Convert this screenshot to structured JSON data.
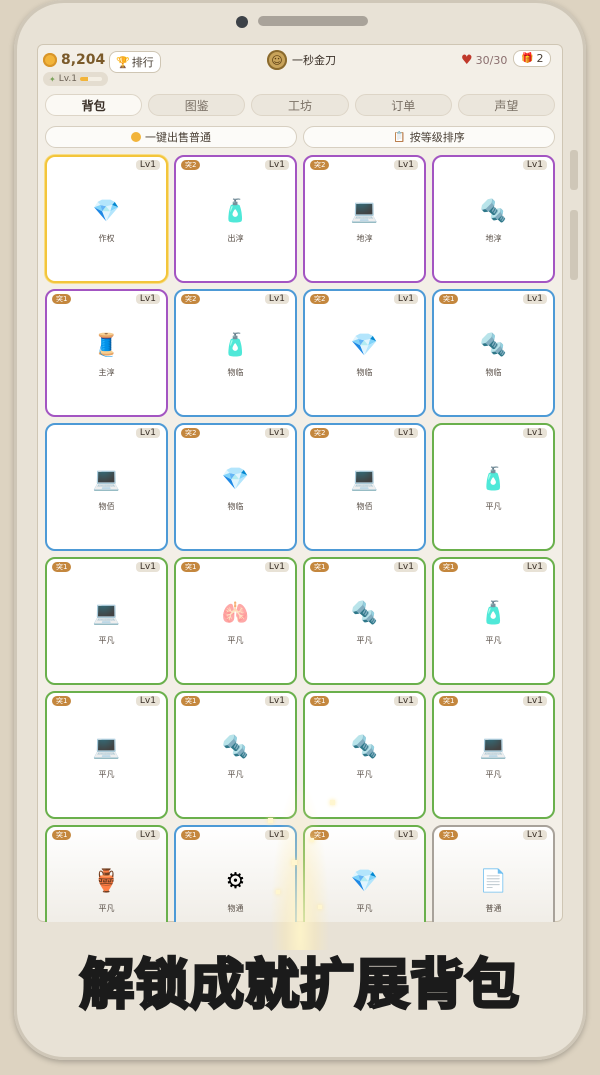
{
  "header": {
    "coins": "8,204",
    "rank_label": "排行",
    "level_label": "Lv.1",
    "level_progress": 0.35,
    "player_name": "一秒金刀",
    "stamina": "30/30",
    "gift_count": "2"
  },
  "tabs": [
    {
      "label": "背包",
      "active": true
    },
    {
      "label": "图鉴",
      "active": false
    },
    {
      "label": "工坊",
      "active": false
    },
    {
      "label": "订单",
      "active": false
    },
    {
      "label": "声望",
      "active": false
    }
  ],
  "actions": {
    "sell_all": "一键出售普通",
    "sort": "按等级排序"
  },
  "items": [
    {
      "lv": "Lv1",
      "badge": "",
      "icon": "💎",
      "icon_name": "diamond-icon",
      "label": "作权",
      "rarity": "gold"
    },
    {
      "lv": "Lv1",
      "badge": "突2",
      "icon": "🧴",
      "icon_name": "lotion-bottle-icon",
      "label": "出淳",
      "rarity": "purple"
    },
    {
      "lv": "Lv1",
      "badge": "突2",
      "icon": "💻",
      "icon_name": "laptop-icon",
      "label": "地淳",
      "rarity": "purple"
    },
    {
      "lv": "Lv1",
      "badge": "",
      "icon": "🔩",
      "icon_name": "bolt-icon",
      "label": "地淳",
      "rarity": "purple"
    },
    {
      "lv": "Lv1",
      "badge": "突1",
      "icon": "🧵",
      "icon_name": "thread-spool-icon",
      "label": "主淳",
      "rarity": "purple"
    },
    {
      "lv": "Lv1",
      "badge": "突2",
      "icon": "🧴",
      "icon_name": "lotion-bottle-icon",
      "label": "物临",
      "rarity": "blue"
    },
    {
      "lv": "Lv1",
      "badge": "突2",
      "icon": "💎",
      "icon_name": "diamond-icon",
      "label": "物临",
      "rarity": "blue"
    },
    {
      "lv": "Lv1",
      "badge": "突1",
      "icon": "🔩",
      "icon_name": "bolt-icon",
      "label": "物临",
      "rarity": "blue"
    },
    {
      "lv": "Lv1",
      "badge": "",
      "icon": "💻",
      "icon_name": "laptop-icon",
      "label": "物佰",
      "rarity": "blue"
    },
    {
      "lv": "Lv1",
      "badge": "突2",
      "icon": "💎",
      "icon_name": "diamond-icon",
      "label": "物临",
      "rarity": "blue"
    },
    {
      "lv": "Lv1",
      "badge": "突2",
      "icon": "💻",
      "icon_name": "laptop-icon",
      "label": "物佰",
      "rarity": "blue"
    },
    {
      "lv": "Lv1",
      "badge": "",
      "icon": "🧴",
      "icon_name": "lotion-bottle-icon",
      "label": "平凡",
      "rarity": "green"
    },
    {
      "lv": "Lv1",
      "badge": "突1",
      "icon": "💻",
      "icon_name": "laptop-icon",
      "label": "平凡",
      "rarity": "green"
    },
    {
      "lv": "Lv1",
      "badge": "突1",
      "icon": "🫁",
      "icon_name": "lungs-icon",
      "label": "平凡",
      "rarity": "green"
    },
    {
      "lv": "Lv1",
      "badge": "突1",
      "icon": "🔩",
      "icon_name": "bolt-icon",
      "label": "平凡",
      "rarity": "green"
    },
    {
      "lv": "Lv1",
      "badge": "突1",
      "icon": "🧴",
      "icon_name": "lotion-bottle-icon",
      "label": "平凡",
      "rarity": "green"
    },
    {
      "lv": "Lv1",
      "badge": "突1",
      "icon": "💻",
      "icon_name": "laptop-icon",
      "label": "平凡",
      "rarity": "green"
    },
    {
      "lv": "Lv1",
      "badge": "突1",
      "icon": "🔩",
      "icon_name": "bolt-icon",
      "label": "平凡",
      "rarity": "green"
    },
    {
      "lv": "Lv1",
      "badge": "突1",
      "icon": "🔩",
      "icon_name": "bolt-icon",
      "label": "平凡",
      "rarity": "green"
    },
    {
      "lv": "Lv1",
      "badge": "突1",
      "icon": "💻",
      "icon_name": "laptop-icon",
      "label": "平凡",
      "rarity": "green"
    },
    {
      "lv": "Lv1",
      "badge": "突1",
      "icon": "🏺",
      "icon_name": "amphora-icon",
      "label": "平凡",
      "rarity": "green"
    },
    {
      "lv": "Lv1",
      "badge": "突1",
      "icon": "⚙",
      "icon_name": "tire-icon",
      "label": "物通",
      "rarity": "blue"
    },
    {
      "lv": "Lv1",
      "badge": "突1",
      "icon": "💎",
      "icon_name": "diamond-icon",
      "label": "平凡",
      "rarity": "green"
    },
    {
      "lv": "Lv1",
      "badge": "突1",
      "icon": "📄",
      "icon_name": "document-icon",
      "label": "普通",
      "rarity": "gray"
    }
  ],
  "caption": "解锁成就扩展背包"
}
